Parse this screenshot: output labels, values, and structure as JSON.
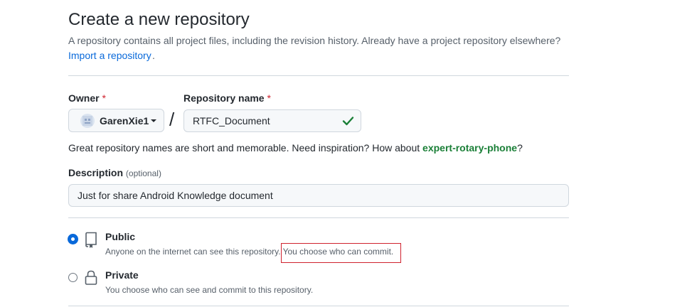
{
  "header": {
    "title": "Create a new repository",
    "subtitle": "A repository contains all project files, including the revision history. Already have a project repository elsewhere?",
    "import_link": "Import a repository",
    "import_suffix": "."
  },
  "owner": {
    "label": "Owner",
    "required_mark": "*",
    "value": "GarenXie1",
    "icon": "avatar"
  },
  "separator": "/",
  "repo_name": {
    "label": "Repository name",
    "required_mark": "*",
    "value": "RTFC_Document",
    "status_icon": "check-icon",
    "status_color": "#1a7f37"
  },
  "hint": {
    "text": "Great repository names are short and memorable. Need inspiration? How about ",
    "suggestion": "expert-rotary-phone",
    "suffix": "?"
  },
  "description": {
    "label": "Description",
    "optional_text": "(optional)",
    "value": "Just for share Android Knowledge document"
  },
  "visibility": {
    "options": [
      {
        "title": "Public",
        "description_part1": "Anyone on the internet can see this repository.",
        "description_part2": "You choose who can commit.",
        "icon": "repo-book-icon",
        "selected": true
      },
      {
        "title": "Private",
        "description_part1": "You choose who can see and commit to this repository.",
        "icon": "lock-icon",
        "selected": false
      }
    ]
  },
  "colors": {
    "link": "#0969da",
    "required": "#cf222e",
    "success": "#1a7f37",
    "annotation_box": "#cf222e"
  }
}
